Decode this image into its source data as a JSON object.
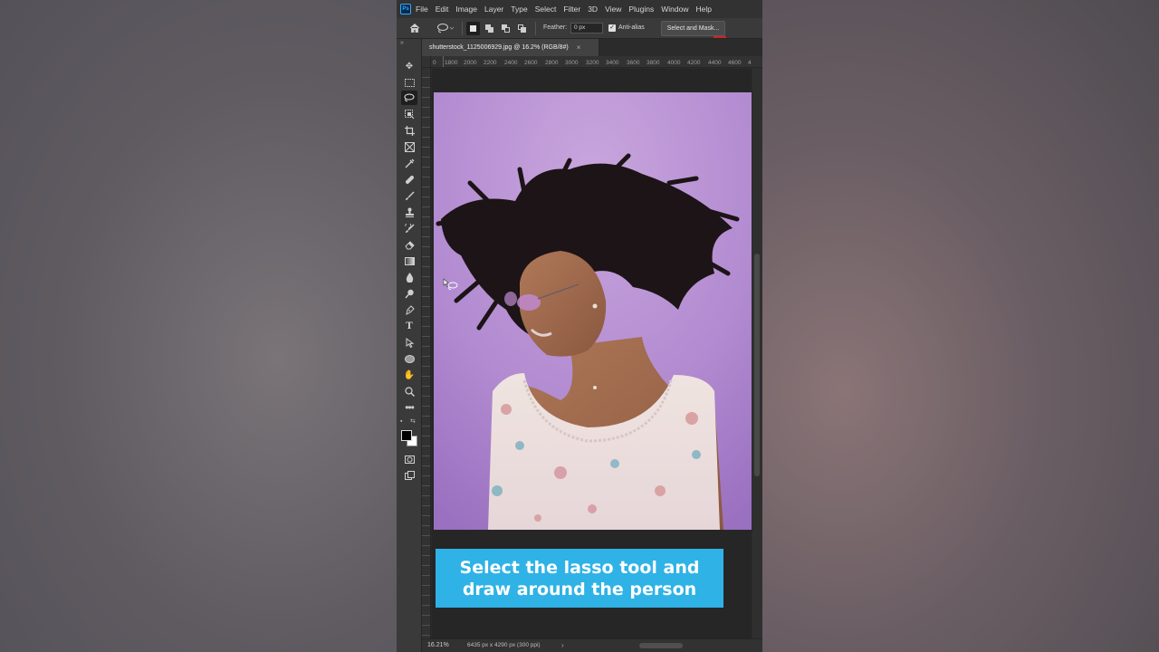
{
  "app": {
    "logo_text": "Ps"
  },
  "menu": [
    "File",
    "Edit",
    "Image",
    "Layer",
    "Type",
    "Select",
    "Filter",
    "3D",
    "View",
    "Plugins",
    "Window",
    "Help"
  ],
  "options_bar": {
    "feather_label": "Feather:",
    "feather_value": "0 px",
    "anti_alias_label": "Anti-alias",
    "anti_alias_checked": true,
    "select_and_mask_label": "Select and Mask..."
  },
  "document": {
    "tab_title": "shutterstock_1125006929.jpg @ 16.2% (RGB/8#)",
    "tab_close": "×",
    "ruler_ticks": [
      "0",
      "1800",
      "2000",
      "2200",
      "2400",
      "2600",
      "2800",
      "3000",
      "3200",
      "3400",
      "3600",
      "3800",
      "4000",
      "4200",
      "4400",
      "4600",
      "4"
    ]
  },
  "toolbar": {
    "tools": [
      "move-tool",
      "marquee-tool",
      "lasso-tool",
      "object-selection-tool",
      "crop-tool",
      "frame-tool",
      "eyedropper-tool",
      "spot-healing-tool",
      "brush-tool",
      "clone-stamp-tool",
      "history-brush-tool",
      "eraser-tool",
      "gradient-tool",
      "blur-tool",
      "dodge-tool",
      "pen-tool",
      "type-tool",
      "path-selection-tool",
      "ellipse-tool",
      "hand-tool",
      "zoom-tool",
      "more-tools"
    ],
    "active_tool": "lasso-tool",
    "foreground_color": "#000000",
    "background_color": "#ffffff"
  },
  "status_bar": {
    "zoom": "16.21%",
    "doc_info": "6435 px x 4290 px (300 ppi)",
    "arrow": "›"
  },
  "caption": {
    "text": "Select the lasso tool and draw around the person",
    "color": "#2fb2e6"
  }
}
